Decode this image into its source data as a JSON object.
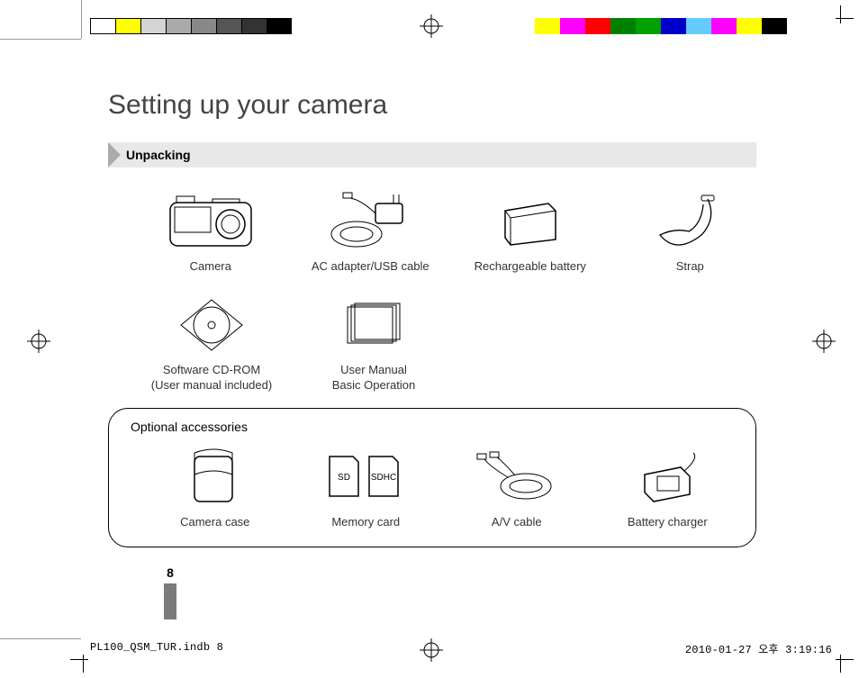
{
  "title": "Setting up your camera",
  "section": {
    "heading": "Unpacking"
  },
  "items_row1": [
    {
      "label": "Camera"
    },
    {
      "label": "AC adapter/USB cable"
    },
    {
      "label": "Rechargeable battery"
    },
    {
      "label": "Strap"
    }
  ],
  "items_row2": [
    {
      "label_line1": "Software CD-ROM",
      "label_line2": "(User manual included)"
    },
    {
      "label_line1": "User Manual",
      "label_line2": "Basic Operation"
    }
  ],
  "optional": {
    "title": "Optional accessories",
    "items": [
      {
        "label": "Camera case"
      },
      {
        "label": "Memory card",
        "card1": "SD",
        "card2": "SDHC"
      },
      {
        "label": "A/V cable"
      },
      {
        "label": "Battery charger"
      }
    ]
  },
  "page_number": "8",
  "footer": {
    "file": "PL100_QSM_TUR.indb   8",
    "date": "2010-01-27   오후 3:19:16"
  },
  "colorbar_left": [
    "#fff",
    "#ffff00",
    "#d4d4d4",
    "#aaaaaa",
    "#888888",
    "#555555",
    "#333333",
    "#000"
  ],
  "colorbar_right": [
    "#ffff00",
    "#ff00ff",
    "#ff0000",
    "#008000",
    "#00a000",
    "#0000cc",
    "#66ccff",
    "#ff00ff",
    "#ffff00",
    "#000"
  ]
}
